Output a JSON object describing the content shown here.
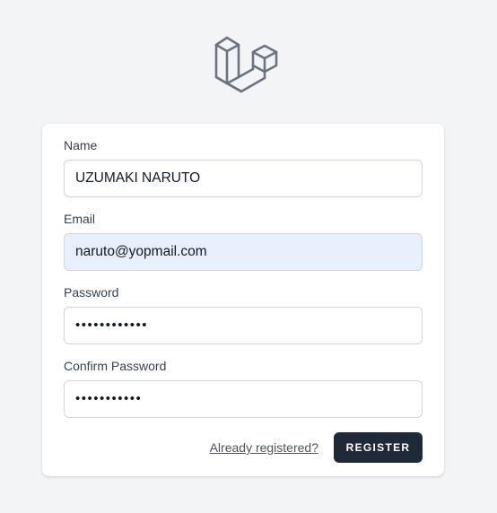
{
  "logo": {
    "icon": "laravel-logo-icon",
    "color": "#6b7280"
  },
  "form": {
    "name": {
      "label": "Name",
      "value": "UZUMAKI NARUTO"
    },
    "email": {
      "label": "Email",
      "value": "naruto@yopmail.com"
    },
    "password": {
      "label": "Password",
      "value": "••••••••••••"
    },
    "confirm_password": {
      "label": "Confirm Password",
      "value": "•••••••••••"
    }
  },
  "actions": {
    "login_link": "Already registered?",
    "register_button": "REGISTER"
  },
  "colors": {
    "background": "#f3f4f6",
    "button": "#1f2937",
    "autofill": "#e8f0fe"
  }
}
